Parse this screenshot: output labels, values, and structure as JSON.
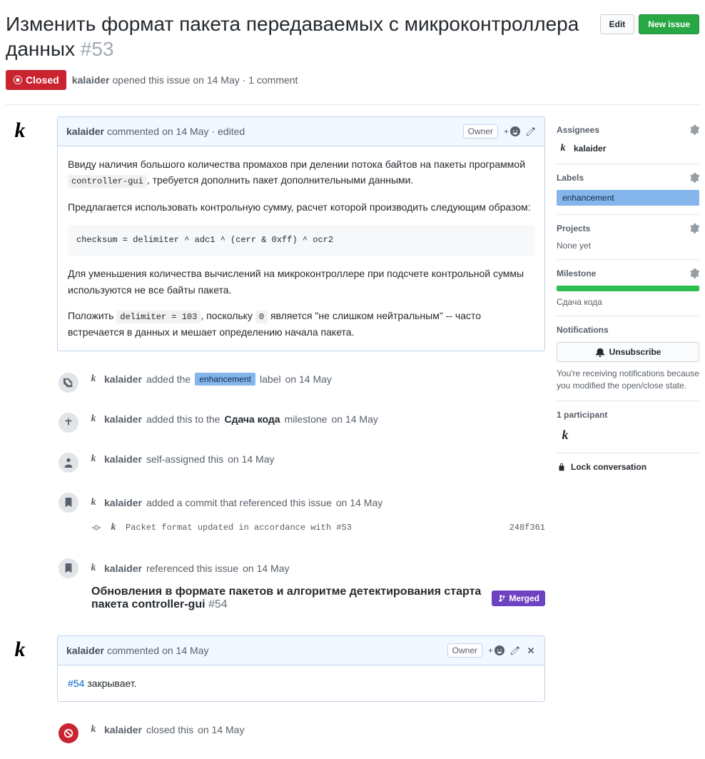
{
  "title": "Изменить формат пакета передаваемых с микроконтроллера данных",
  "issue_number": "#53",
  "buttons": {
    "edit": "Edit",
    "new_issue": "New issue"
  },
  "state": "Closed",
  "opener": {
    "author": "kalaider",
    "text_prefix": " opened this issue ",
    "date": "on 14 May",
    "suffix": " · 1 comment"
  },
  "comment1": {
    "author": "kalaider",
    "verb": " commented ",
    "date": "on 14 May",
    "edited": " · edited",
    "owner_badge": "Owner",
    "p1_a": "Ввиду наличия большого количества промахов при делении потока байтов на пакеты программой ",
    "p1_code": "controller-gui",
    "p1_b": ", требуется дополнить пакет дополнительными данными.",
    "p2": "Предлагается использовать контрольную сумму, расчет которой производить следующим образом:",
    "code_block": "checksum = delimiter ^ adc1 ^ (cerr & 0xff) ^ ocr2",
    "p3": "Для уменьшения количества вычислений на микроконтроллере при подсчете контрольной суммы используются не все байты пакета.",
    "p4_a": "Положить ",
    "p4_code1": "delimiter = 103",
    "p4_b": ", поскольку ",
    "p4_code2": "0",
    "p4_c": " является \"не слишком нейтральным\" -- часто встречается в данных и мешает определению начала пакета."
  },
  "timeline": {
    "t1": {
      "author": "kalaider",
      "a": " added the ",
      "label": "enhancement",
      "b": " label ",
      "date": "on 14 May"
    },
    "t2": {
      "author": "kalaider",
      "a": " added this to the ",
      "milestone": "Сдача кода",
      "b": " milestone ",
      "date": "on 14 May"
    },
    "t3": {
      "author": "kalaider",
      "a": " self-assigned this ",
      "date": "on 14 May"
    },
    "t4": {
      "author": "kalaider",
      "a": " added a commit that referenced this issue ",
      "date": "on 14 May"
    },
    "commit": {
      "msg": "Packet format updated in accordance with #53",
      "sha": "248f361"
    },
    "t5": {
      "author": "kalaider",
      "a": " referenced this issue ",
      "date": "on 14 May"
    },
    "ref": {
      "title": "Обновления в формате пакетов и алгоритме детектирования старта пакета controller-gui ",
      "num": "#54",
      "badge": "Merged"
    },
    "t7": {
      "author": "kalaider",
      "a": " closed this ",
      "date": "on 14 May"
    }
  },
  "comment2": {
    "author": "kalaider",
    "verb": " commented ",
    "date": "on 14 May",
    "owner_badge": "Owner",
    "link": "#54",
    "text": " закрывает."
  },
  "sidebar": {
    "assignees": {
      "heading": "Assignees",
      "user": "kalaider"
    },
    "labels": {
      "heading": "Labels",
      "label": "enhancement"
    },
    "projects": {
      "heading": "Projects",
      "none": "None yet"
    },
    "milestone": {
      "heading": "Milestone",
      "name": "Сдача кода"
    },
    "notifications": {
      "heading": "Notifications",
      "button": "Unsubscribe",
      "note": "You're receiving notifications because you modified the open/close state."
    },
    "participants": {
      "heading": "1 participant"
    },
    "lock": "Lock conversation"
  }
}
